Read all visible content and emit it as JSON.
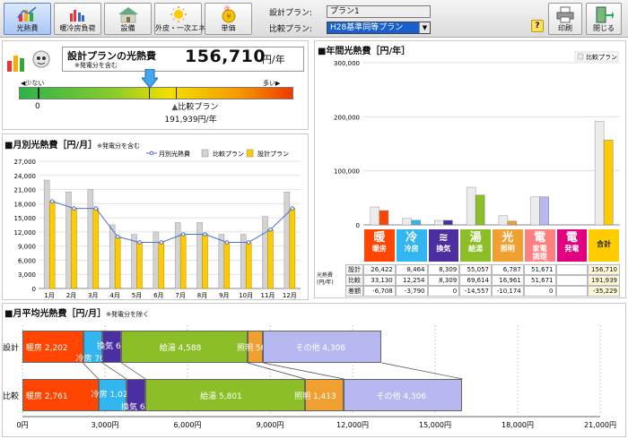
{
  "toolbar": {
    "buttons": [
      {
        "id": "kounetsu",
        "label": "光熱費"
      },
      {
        "id": "danbou",
        "label": "暖冷房負荷"
      },
      {
        "id": "setsubi",
        "label": "設備"
      },
      {
        "id": "gaihi",
        "label": "外皮・一次エネ"
      },
      {
        "id": "tanka",
        "label": "単価"
      }
    ],
    "design_plan_label": "設計プラン:",
    "design_plan_value": "プラン1",
    "compare_plan_label": "比較プラン:",
    "compare_plan_value": "H28基準同等プラン",
    "help_label": "?",
    "print_label": "印刷",
    "close_label": "閉じる"
  },
  "summary": {
    "title": "設計プランの光熱費",
    "note": "※発電分を含む",
    "value": "156,710",
    "unit": "円/年",
    "scale_low": "少ない",
    "scale_high": "多い",
    "scale_zero": "0",
    "compare_label": "比較プラン",
    "compare_value": "191,939円/年",
    "design_position": 0.47,
    "compare_position": 0.57
  },
  "monthly": {
    "title": "■月別光熱費［円/月］",
    "note": "※発電分を含む"
  },
  "annual": {
    "title": "■年間光熱費［円/年］",
    "table": {
      "header_row_label": "光熱費\n(円/年)",
      "columns": [
        {
          "name": "暖房",
          "icon": "暖",
          "color": "#ff4500"
        },
        {
          "name": "冷房",
          "icon": "冷",
          "color": "#33b5ef"
        },
        {
          "name": "換気",
          "icon": "≋",
          "color": "#4b2fa0"
        },
        {
          "name": "給湯",
          "icon": "湯",
          "color": "#8cbe28"
        },
        {
          "name": "照明",
          "icon": "光",
          "color": "#f0a030"
        },
        {
          "name": "その他",
          "icon": "電",
          "color": "#ff8080"
        },
        {
          "name": "発電",
          "icon": "電",
          "color": "#e2007f"
        },
        {
          "name": "合計",
          "icon": "",
          "color": "#ffcc00"
        }
      ],
      "top_labels": [
        "暖房",
        "冷房",
        "換気",
        "給湯",
        "照明",
        "家電\n調理\nその他",
        "発電",
        "合計"
      ],
      "rows": [
        {
          "label": "設計",
          "values": [
            "26,422",
            "8,464",
            "8,309",
            "55,057",
            "6,787",
            "51,671",
            "",
            "156,710"
          ]
        },
        {
          "label": "比較",
          "values": [
            "33,130",
            "12,254",
            "8,309",
            "69,614",
            "16,961",
            "51,671",
            "",
            "191,939"
          ]
        },
        {
          "label": "差額",
          "values": [
            "-6,708",
            "-3,790",
            "0",
            "-14,557",
            "-10,174",
            "0",
            "",
            "-35,229"
          ]
        }
      ]
    }
  },
  "avg": {
    "title": "■月平均光熱費［円/月］",
    "note": "※発電分を除く",
    "rows": [
      {
        "label": "設計",
        "segments": [
          {
            "name": "暖房",
            "value": 2202,
            "text": "暖房 2,202",
            "color": "#ff4500"
          },
          {
            "name": "冷房",
            "value": 705,
            "text": "冷房 705",
            "color": "#33b5ef"
          },
          {
            "name": "換気",
            "value": 692,
            "text": "換気 692",
            "color": "#4b2fa0"
          },
          {
            "name": "給湯",
            "value": 4588,
            "text": "給湯 4,588",
            "color": "#8cbe28"
          },
          {
            "name": "照明",
            "value": 566,
            "text": "照明 566",
            "color": "#f0a030"
          },
          {
            "name": "その他",
            "value": 4306,
            "text": "その他 4,306",
            "color": "#b8b8f0"
          }
        ]
      },
      {
        "label": "比較",
        "segments": [
          {
            "name": "暖房",
            "value": 2761,
            "text": "暖房 2,761",
            "color": "#ff4500"
          },
          {
            "name": "冷房",
            "value": 1021,
            "text": "冷房 1,021",
            "color": "#33b5ef"
          },
          {
            "name": "換気",
            "value": 692,
            "text": "換気 692",
            "color": "#4b2fa0"
          },
          {
            "name": "給湯",
            "value": 5801,
            "text": "給湯 5,801",
            "color": "#8cbe28"
          },
          {
            "name": "照明",
            "value": 1413,
            "text": "照明 1,413",
            "color": "#f0a030"
          },
          {
            "name": "その他",
            "value": 4306,
            "text": "その他 4,306",
            "color": "#b8b8f0"
          }
        ]
      }
    ],
    "axis_ticks": [
      "0円",
      "3,000円",
      "6,000円",
      "9,000円",
      "12,000円",
      "15,000円",
      "18,000円",
      "21,000円"
    ]
  },
  "chart_data": [
    {
      "type": "bar",
      "title": "月別光熱費［円/月］",
      "categories": [
        "1月",
        "2月",
        "3月",
        "4月",
        "5月",
        "6月",
        "7月",
        "8月",
        "9月",
        "10月",
        "11月",
        "12月"
      ],
      "ylim": [
        0,
        27000
      ],
      "yticks": [
        "0",
        "3,000",
        "6,000",
        "9,000",
        "12,000",
        "15,000",
        "18,000",
        "21,000",
        "24,000",
        "27,000"
      ],
      "legend": [
        "月別光熱費",
        "比較プラン",
        "設計プラン"
      ],
      "legend_position": "top-right",
      "series": [
        {
          "name": "比較プラン",
          "color": "#d3d3d3",
          "values": [
            23000,
            20500,
            21000,
            13500,
            11500,
            12000,
            14000,
            14000,
            11500,
            11500,
            15300,
            20500
          ]
        },
        {
          "name": "設計プラン",
          "color": "#ffcc00",
          "values": [
            18500,
            17000,
            17000,
            11000,
            9800,
            9800,
            11500,
            11500,
            9800,
            9800,
            12500,
            17000
          ]
        },
        {
          "name": "月別光熱費",
          "type": "line",
          "color": "#4a6fd8",
          "values": [
            18500,
            17000,
            17000,
            11000,
            9800,
            9800,
            11500,
            11500,
            9800,
            9800,
            12500,
            17000
          ]
        }
      ]
    },
    {
      "type": "bar",
      "title": "年間光熱費［円/年］",
      "categories": [
        "暖房",
        "冷房",
        "換気",
        "給湯",
        "照明",
        "その他",
        "発電",
        "合計"
      ],
      "ylim": [
        0,
        300000
      ],
      "yticks": [
        "0",
        "100,000",
        "200,000",
        "300,000"
      ],
      "legend": [
        "比較プラン"
      ],
      "legend_position": "top-right",
      "series": [
        {
          "name": "比較プラン",
          "values": [
            33130,
            12254,
            8309,
            69614,
            16961,
            51671,
            0,
            191939
          ]
        },
        {
          "name": "設計プラン",
          "values": [
            26422,
            8464,
            8309,
            55057,
            6787,
            51671,
            0,
            156710
          ]
        }
      ]
    },
    {
      "type": "bar",
      "title": "月平均光熱費［円/月］",
      "categories": [
        "設計",
        "比較"
      ],
      "xlim": [
        0,
        21000
      ],
      "series": [
        {
          "name": "暖房",
          "values": [
            2202,
            2761
          ]
        },
        {
          "name": "冷房",
          "values": [
            705,
            1021
          ]
        },
        {
          "name": "換気",
          "values": [
            692,
            692
          ]
        },
        {
          "name": "給湯",
          "values": [
            4588,
            5801
          ]
        },
        {
          "name": "照明",
          "values": [
            566,
            1413
          ]
        },
        {
          "name": "その他",
          "values": [
            4306,
            4306
          ]
        }
      ]
    }
  ]
}
